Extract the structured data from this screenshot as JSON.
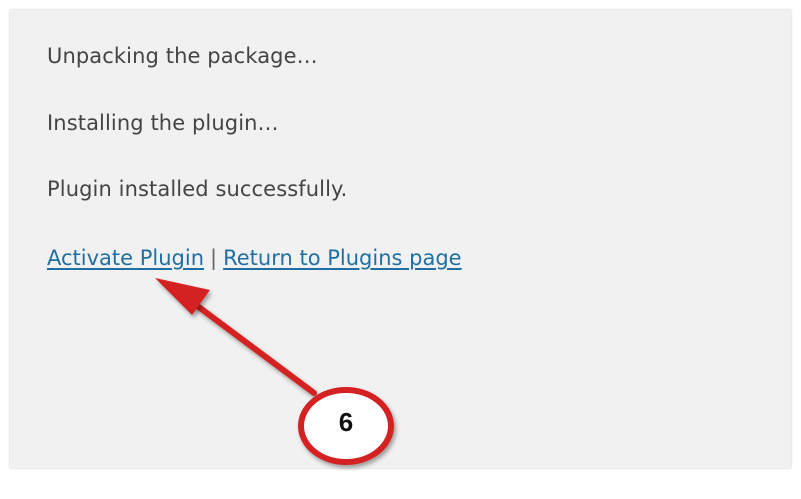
{
  "messages": {
    "unpacking": "Unpacking the package…",
    "installing": "Installing the plugin…",
    "success": "Plugin installed successfully."
  },
  "actions": {
    "activate_label": "Activate Plugin",
    "separator": "|",
    "return_label": "Return to Plugins page"
  },
  "annotation": {
    "step_number": "6",
    "icon": "red-arrow-callout"
  },
  "colors": {
    "panel_bg": "#f1f1f1",
    "text": "#444444",
    "link": "#1f6fa3",
    "annotation": "#d42020"
  }
}
